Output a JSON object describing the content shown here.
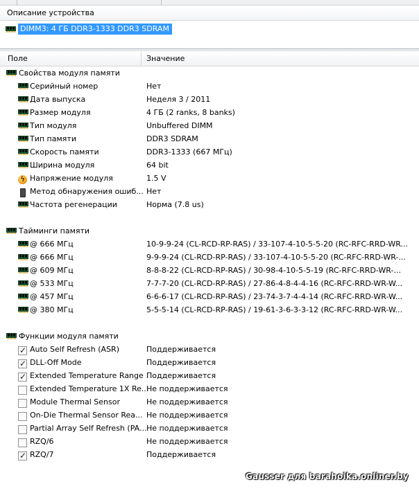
{
  "panels": {
    "description_header": "Описание устройства",
    "device_title": "DIMM3: 4 ГБ DDR3-1333 DDR3 SDRAM"
  },
  "columns": {
    "field": "Поле",
    "value": "Значение"
  },
  "sections": {
    "properties": {
      "title": "Свойства модуля памяти",
      "rows": [
        {
          "label": "Серийный номер",
          "value": "Нет",
          "icon": "memory-module-icon"
        },
        {
          "label": "Дата выпуска",
          "value": "Неделя 3 / 2011",
          "icon": "memory-module-icon"
        },
        {
          "label": "Размер модуля",
          "value": "4 ГБ (2 ranks, 8 banks)",
          "icon": "memory-module-icon"
        },
        {
          "label": "Тип модуля",
          "value": "Unbuffered DIMM",
          "icon": "memory-module-icon"
        },
        {
          "label": "Тип памяти",
          "value": "DDR3 SDRAM",
          "icon": "memory-module-icon"
        },
        {
          "label": "Скорость памяти",
          "value": "DDR3-1333 (667 МГц)",
          "icon": "memory-module-icon"
        },
        {
          "label": "Ширина модуля",
          "value": "64 bit",
          "icon": "memory-module-icon"
        },
        {
          "label": "Напряжение модуля",
          "value": "1.5 V",
          "icon": "voltage-icon"
        },
        {
          "label": "Метод обнаружения ошиб...",
          "value": "Нет",
          "icon": "error-detection-icon"
        },
        {
          "label": "Частота регенерации",
          "value": "Норма (7.8 us)",
          "icon": "memory-module-icon"
        }
      ]
    },
    "timings": {
      "title": "Тайминги памяти",
      "rows": [
        {
          "label": "@ 666 МГц",
          "value": "10-9-9-24  (CL-RCD-RP-RAS) / 33-107-4-10-5-5-20  (RC-RFC-RRD-WR..."
        },
        {
          "label": "@ 666 МГц",
          "value": "9-9-9-24  (CL-RCD-RP-RAS) / 33-107-4-10-5-5-20  (RC-RFC-RRD-WR-..."
        },
        {
          "label": "@ 609 МГц",
          "value": "8-8-8-22  (CL-RCD-RP-RAS) / 30-98-4-10-5-5-19  (RC-RFC-RRD-WR-..."
        },
        {
          "label": "@ 533 МГц",
          "value": "7-7-7-20  (CL-RCD-RP-RAS) / 27-86-4-8-4-4-16  (RC-RFC-RRD-WR-W..."
        },
        {
          "label": "@ 457 МГц",
          "value": "6-6-6-17  (CL-RCD-RP-RAS) / 23-74-3-7-4-4-14  (RC-RFC-RRD-WR-W..."
        },
        {
          "label": "@ 380 МГц",
          "value": "5-5-5-14  (CL-RCD-RP-RAS) / 19-61-3-6-3-3-12  (RC-RFC-RRD-WR-W..."
        }
      ]
    },
    "features": {
      "title": "Функции модуля памяти",
      "rows": [
        {
          "label": "Auto Self Refresh (ASR)",
          "value": "Поддерживается",
          "checked": true
        },
        {
          "label": "DLL-Off Mode",
          "value": "Поддерживается",
          "checked": true
        },
        {
          "label": "Extended Temperature Range",
          "value": "Поддерживается",
          "checked": true
        },
        {
          "label": "Extended Temperature 1X Re...",
          "value": "Не поддерживается",
          "checked": false
        },
        {
          "label": "Module Thermal Sensor",
          "value": "Не поддерживается",
          "checked": false
        },
        {
          "label": "On-Die Thermal Sensor Rea...",
          "value": "Не поддерживается",
          "checked": false
        },
        {
          "label": "Partial Array Self Refresh (PA...",
          "value": "Не поддерживается",
          "checked": false
        },
        {
          "label": "RZQ/6",
          "value": "Не поддерживается",
          "checked": false
        },
        {
          "label": "RZQ/7",
          "value": "Поддерживается",
          "checked": true
        }
      ]
    }
  },
  "watermark": "Gausser для barahoika.onliner.by"
}
